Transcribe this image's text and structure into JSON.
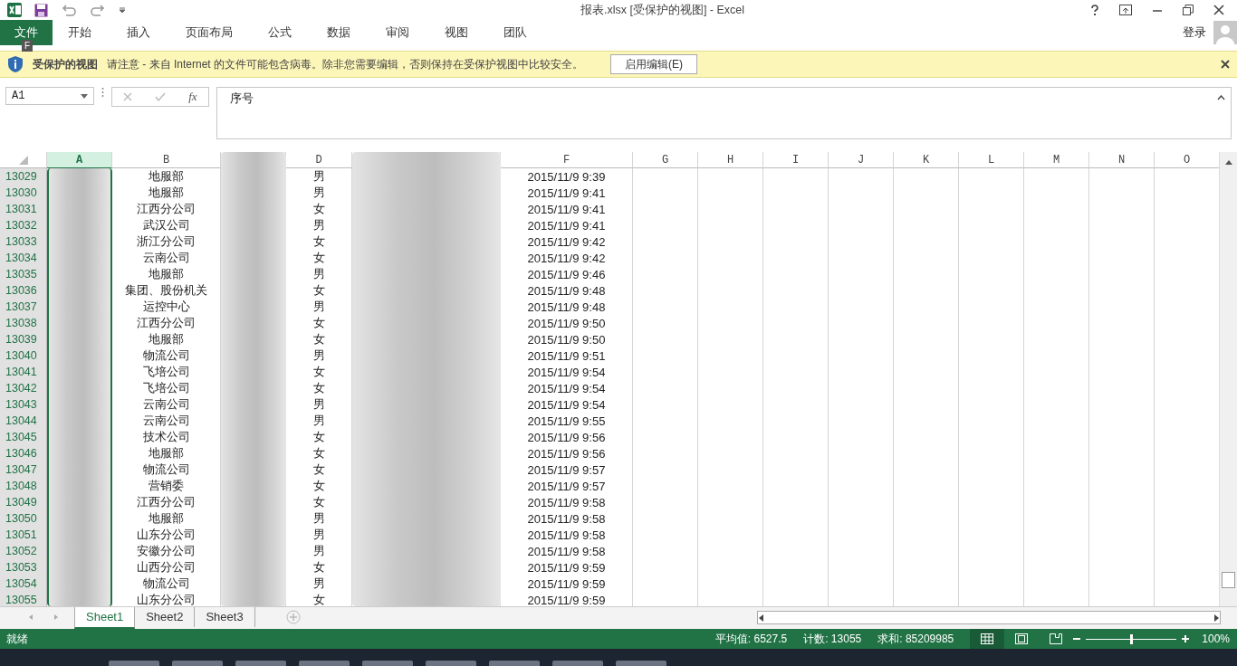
{
  "window": {
    "title": "报表.xlsx  [受保护的视图] - Excel",
    "signin": "登录"
  },
  "ribbon_tabs": [
    {
      "label": "文件",
      "selected": true,
      "kind": "file",
      "keytip": "F"
    },
    {
      "label": "开始",
      "selected": false,
      "kind": "tab"
    },
    {
      "label": "插入",
      "selected": false,
      "kind": "tab"
    },
    {
      "label": "页面布局",
      "selected": false,
      "kind": "tab"
    },
    {
      "label": "公式",
      "selected": false,
      "kind": "tab"
    },
    {
      "label": "数据",
      "selected": false,
      "kind": "tab"
    },
    {
      "label": "审阅",
      "selected": false,
      "kind": "tab"
    },
    {
      "label": "视图",
      "selected": false,
      "kind": "tab"
    },
    {
      "label": "团队",
      "selected": false,
      "kind": "tab"
    }
  ],
  "protected_bar": {
    "title": "受保护的视图",
    "message": "请注意 - 来自 Internet 的文件可能包含病毒。除非您需要编辑，否则保持在受保护视图中比较安全。",
    "button": "启用编辑(E)"
  },
  "formula_bar": {
    "name_box": "A1",
    "fx": "fx",
    "value": "序号"
  },
  "columns": [
    {
      "letter": "A",
      "selected": true,
      "redacted": true
    },
    {
      "letter": "B",
      "selected": false,
      "redacted": false
    },
    {
      "redacted": true
    },
    {
      "letter": "D",
      "selected": false,
      "redacted": false
    },
    {
      "redacted": true
    },
    {
      "letter": "F",
      "selected": false,
      "redacted": false
    },
    {
      "letter": "G",
      "selected": false,
      "redacted": false
    },
    {
      "letter": "H",
      "selected": false,
      "redacted": false
    },
    {
      "letter": "I",
      "selected": false,
      "redacted": false
    },
    {
      "letter": "J",
      "selected": false,
      "redacted": false
    },
    {
      "letter": "K",
      "selected": false,
      "redacted": false
    },
    {
      "letter": "L",
      "selected": false,
      "redacted": false
    },
    {
      "letter": "M",
      "selected": false,
      "redacted": false
    },
    {
      "letter": "N",
      "selected": false,
      "redacted": false
    },
    {
      "letter": "O",
      "selected": false,
      "redacted": false
    }
  ],
  "rows": [
    {
      "row": "13029",
      "b": "地服部",
      "d": "男",
      "f": "2015/11/9 9:39"
    },
    {
      "row": "13030",
      "b": "地服部",
      "d": "男",
      "f": "2015/11/9 9:41"
    },
    {
      "row": "13031",
      "b": "江西分公司",
      "d": "女",
      "f": "2015/11/9 9:41"
    },
    {
      "row": "13032",
      "b": "武汉公司",
      "d": "男",
      "f": "2015/11/9 9:41"
    },
    {
      "row": "13033",
      "b": "浙江分公司",
      "d": "女",
      "f": "2015/11/9 9:42"
    },
    {
      "row": "13034",
      "b": "云南公司",
      "d": "女",
      "f": "2015/11/9 9:42"
    },
    {
      "row": "13035",
      "b": "地服部",
      "d": "男",
      "f": "2015/11/9 9:46"
    },
    {
      "row": "13036",
      "b": "集团、股份机关",
      "d": "女",
      "f": "2015/11/9 9:48"
    },
    {
      "row": "13037",
      "b": "运控中心",
      "d": "男",
      "f": "2015/11/9 9:48"
    },
    {
      "row": "13038",
      "b": "江西分公司",
      "d": "女",
      "f": "2015/11/9 9:50"
    },
    {
      "row": "13039",
      "b": "地服部",
      "d": "女",
      "f": "2015/11/9 9:50"
    },
    {
      "row": "13040",
      "b": "物流公司",
      "d": "男",
      "f": "2015/11/9 9:51"
    },
    {
      "row": "13041",
      "b": "飞培公司",
      "d": "女",
      "f": "2015/11/9 9:54"
    },
    {
      "row": "13042",
      "b": "飞培公司",
      "d": "女",
      "f": "2015/11/9 9:54"
    },
    {
      "row": "13043",
      "b": "云南公司",
      "d": "男",
      "f": "2015/11/9 9:54"
    },
    {
      "row": "13044",
      "b": "云南公司",
      "d": "男",
      "f": "2015/11/9 9:55"
    },
    {
      "row": "13045",
      "b": "技术公司",
      "d": "女",
      "f": "2015/11/9 9:56"
    },
    {
      "row": "13046",
      "b": "地服部",
      "d": "女",
      "f": "2015/11/9 9:56"
    },
    {
      "row": "13047",
      "b": "物流公司",
      "d": "女",
      "f": "2015/11/9 9:57"
    },
    {
      "row": "13048",
      "b": "营销委",
      "d": "女",
      "f": "2015/11/9 9:57"
    },
    {
      "row": "13049",
      "b": "江西分公司",
      "d": "女",
      "f": "2015/11/9 9:58"
    },
    {
      "row": "13050",
      "b": "地服部",
      "d": "男",
      "f": "2015/11/9 9:58"
    },
    {
      "row": "13051",
      "b": "山东分公司",
      "d": "男",
      "f": "2015/11/9 9:58"
    },
    {
      "row": "13052",
      "b": "安徽分公司",
      "d": "男",
      "f": "2015/11/9 9:58"
    },
    {
      "row": "13053",
      "b": "山西分公司",
      "d": "女",
      "f": "2015/11/9 9:59"
    },
    {
      "row": "13054",
      "b": "物流公司",
      "d": "男",
      "f": "2015/11/9 9:59"
    },
    {
      "row": "13055",
      "b": "山东分公司",
      "d": "女",
      "f": "2015/11/9 9:59"
    }
  ],
  "sheets": [
    {
      "label": "Sheet1",
      "selected": true
    },
    {
      "label": "Sheet2",
      "selected": false
    },
    {
      "label": "Sheet3",
      "selected": false
    }
  ],
  "status_bar": {
    "status": "就绪",
    "stats": [
      "平均值: 6527.5",
      "计数: 13055",
      "求和: 85209985"
    ],
    "views": [
      {
        "kind": "normal",
        "selected": true
      },
      {
        "kind": "page",
        "selected": false
      },
      {
        "kind": "break",
        "selected": false
      }
    ],
    "zoom": {
      "level": 0.5,
      "label": "100%"
    }
  }
}
